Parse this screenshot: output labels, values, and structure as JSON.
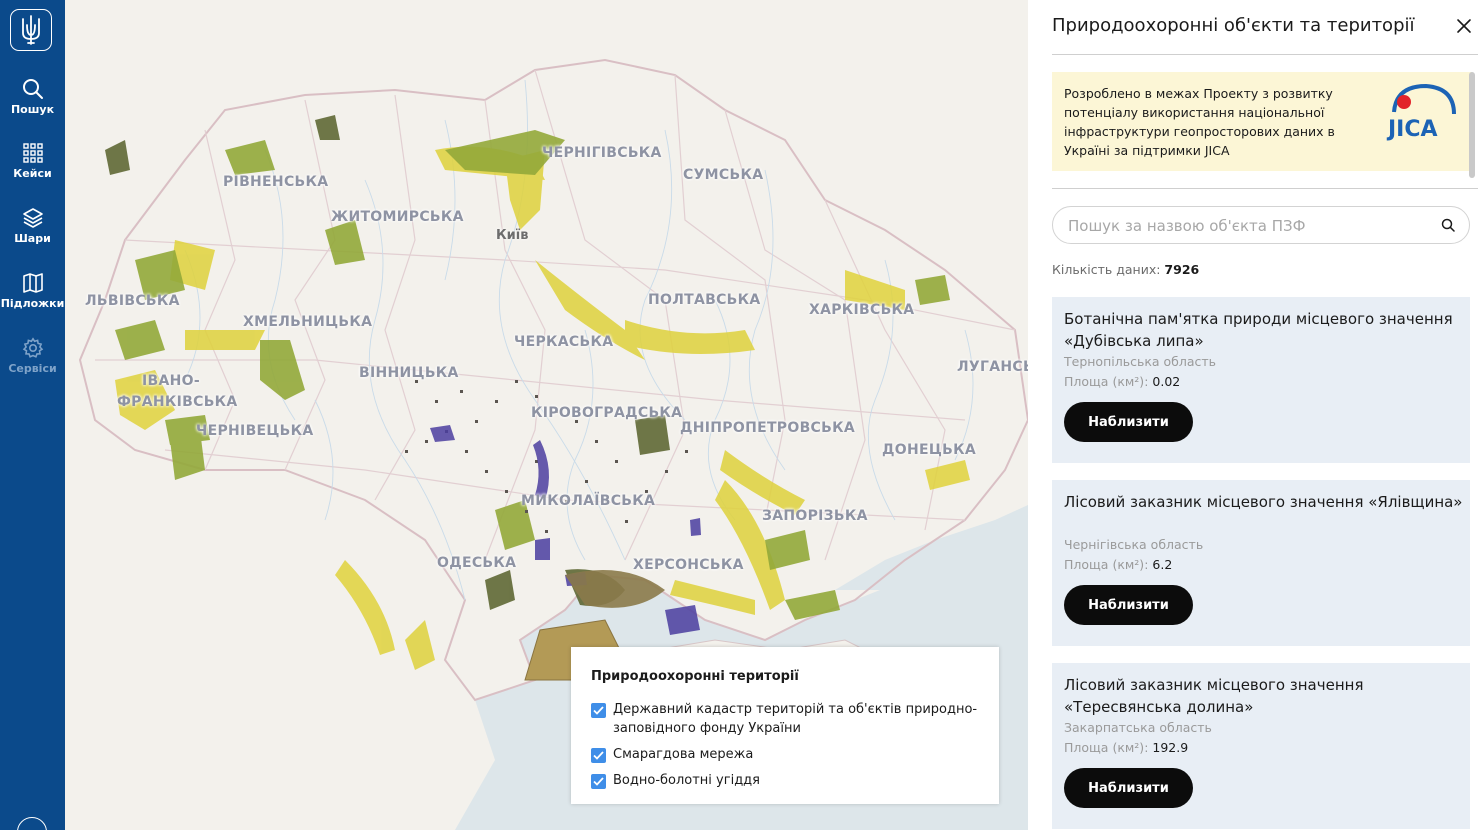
{
  "colors": {
    "sidebar": "#0b4a8b",
    "accent": "#3f8ee8",
    "card_bg": "#e8eef5",
    "jica_bg": "#fcf6d6",
    "button": "#0c0c0c",
    "map_land": "#f3f1ec",
    "map_sea": "#dde6ea",
    "zone_yellow": "#dfd23c",
    "zone_green": "#93a93a",
    "zone_dark": "#56602a",
    "zone_purple": "#4b3ea0"
  },
  "sidebar": {
    "logo_icon": "trident-emblem-icon",
    "items": [
      {
        "label": "Пошук",
        "icon": "search-icon"
      },
      {
        "label": "Кейси",
        "icon": "grid-icon"
      },
      {
        "label": "Шари",
        "icon": "layers-icon"
      },
      {
        "label": "Підложки",
        "icon": "map-icon"
      },
      {
        "label": "Сервіси",
        "icon": "gear-icon"
      }
    ]
  },
  "map": {
    "regions": [
      "ЧЕРНІГІВСЬКА",
      "СУМСЬКА",
      "РІВНЕНСЬКА",
      "ЖИТОМИРСЬКА",
      "ЛЬВІВСЬКА",
      "ХМЕЛЬНИЦЬКА",
      "ПОЛТАВСЬКА",
      "ХАРКІВСЬКА",
      "ЧЕРКАСЬКА",
      "ВІННИЦЬКА",
      "ЛУГАНСЬ",
      "ІВАНО-",
      "ФРАНКІВСЬКА",
      "КІРОВОГРАДСЬКА",
      "ЧЕРНІВЕЦЬКА",
      "ДНІПРОПЕТРОВСЬКА",
      "ДОНЕЦЬКА",
      "МИКОЛАЇВСЬКА",
      "ЗАПОРІЗЬКА",
      "ОДЕСЬКА",
      "ХЕРСОНСЬКА"
    ],
    "city": "Київ"
  },
  "legend": {
    "title": "Природоохоронні території",
    "items": [
      {
        "label": "Державний кадастр територій та об'єктів природно-заповідного фонду України",
        "checked": true
      },
      {
        "label": "Смарагдова мережа",
        "checked": true
      },
      {
        "label": "Водно-болотні угіддя",
        "checked": true
      }
    ]
  },
  "panel": {
    "title": "Природоохоронні об'єкти та території",
    "jica_text": "Розроблено в межах Проекту з розвитку потенціалу використання національної інфраструктури геопросторових даних в Україні за підтримки JICA",
    "jica_logo_text": "JICA",
    "search_placeholder": "Пошук за назвою об'єкта ПЗФ",
    "search_value": "",
    "count_label": "Кількість даних:",
    "count_value": "7926",
    "area_label": "Площа (км²):",
    "button_label": "Наблизити",
    "cards": [
      {
        "title": "Ботанічна пам'ятка природи місцевого значення «Дубівська липа»",
        "region": "Тернопільська область",
        "area": "0.02"
      },
      {
        "title": "Лісовий заказник місцевого значення «Ялівщина»",
        "region": "Чернігівська область",
        "area": "6.2"
      },
      {
        "title": "Лісовий заказник місцевого значення «Тересвянська долина»",
        "region": "Закарпатська область",
        "area": "192.9"
      }
    ]
  }
}
